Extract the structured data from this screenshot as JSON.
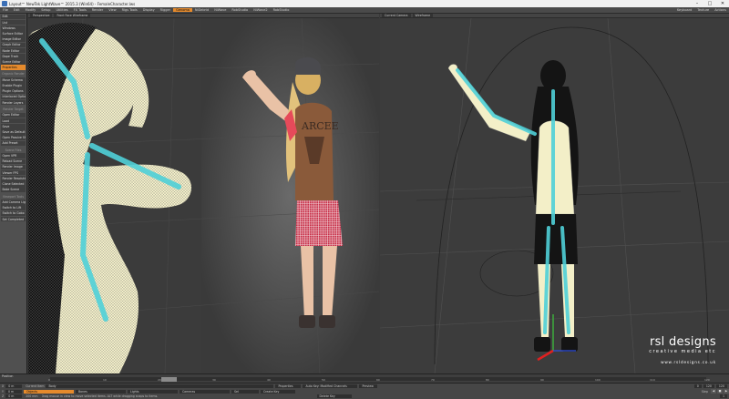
{
  "window": {
    "title": "Layout™ NewTek LightWave™ 2015.3 (Win64) - FemaleCharacter.lws",
    "minimize": "–",
    "maximize": "□",
    "close": "✕"
  },
  "menubar": {
    "items": [
      "File",
      "Edit",
      "Modify",
      "Setup",
      "Utilities",
      "FX Tools",
      "Render",
      "View",
      "Rigs Tools",
      "Display",
      "Rigger",
      "Genoma",
      "NiDebrid",
      "NiWave",
      "RobStudio",
      "NiWave2",
      "RobStudio"
    ],
    "active_index": 11,
    "right": [
      "Keyboard",
      "Texture",
      "Actions"
    ]
  },
  "sidebar": {
    "groups": [
      {
        "title": "",
        "items": [
          "Edit",
          "List",
          "Windows"
        ]
      },
      {
        "title": "",
        "items": [
          "Surface Editor",
          "Image Editor",
          "Graph Editor",
          "Node Editor",
          "Dope Track",
          "Scene Editor",
          "Properties"
        ]
      },
      {
        "title": "Organic Render",
        "items": [
          "Move Schema",
          "Enable Plugin",
          "Plugin Options",
          "Interlaced Options",
          "Render Layers"
        ]
      },
      {
        "title": "Render Target",
        "items": [
          "Open Editor",
          "Load",
          "Save",
          "Save as Default",
          "Open Passive Shell",
          "Add Preset"
        ]
      },
      {
        "title": "Scene Files",
        "items": [
          "Open VPR",
          "Reload Scene",
          "Render Image",
          "Viewer FPS",
          "Render Resolution",
          "Clone Selected",
          "Bake Scene"
        ]
      },
      {
        "title": "Viewport Tools",
        "items": [
          "Add Camera Light",
          "Switch to Lift",
          "Switch to Gobo",
          "Set Completed"
        ]
      }
    ],
    "highlight": "Properties"
  },
  "viewport_left": {
    "view": "Perspective",
    "mode": "Front Face Wireframe"
  },
  "viewport_right": {
    "view": "Current Camera",
    "mode": "Wireframe"
  },
  "watermark": {
    "brand": "rsl designs",
    "tagline": "creative media etc",
    "url": "www.rsldesigns.co.uk"
  },
  "timeline": {
    "label": "Position",
    "ticks": [
      "0",
      "10",
      "20",
      "30",
      "40",
      "50",
      "60",
      "70",
      "80",
      "90",
      "100",
      "110",
      "120"
    ],
    "current_frame": "0"
  },
  "bottom": {
    "row1": {
      "x_label": "X",
      "x_val": "0 m",
      "current_item": "Current Item",
      "current_val": "Body",
      "properties": "Properties",
      "auto_key": "Auto Key: Modified Channels",
      "preview": "Preview",
      "frame_a": "0",
      "frame_b": "120",
      "frame_c": "120"
    },
    "row2": {
      "y_label": "Y",
      "y_val": "0 m",
      "objects": "Objects",
      "bones": "Bones",
      "lights": "Lights",
      "cameras": "Cameras",
      "sel": "Sel",
      "create_key": "Create Key",
      "step": "Step"
    },
    "row3": {
      "z_label": "Z",
      "z_val": "0 m",
      "grid": "200 mm",
      "status": "Drag mouse in view to move selected items. ALT while dragging snaps to items.",
      "delete_key": "Delete Key",
      "step_val": "1"
    }
  }
}
